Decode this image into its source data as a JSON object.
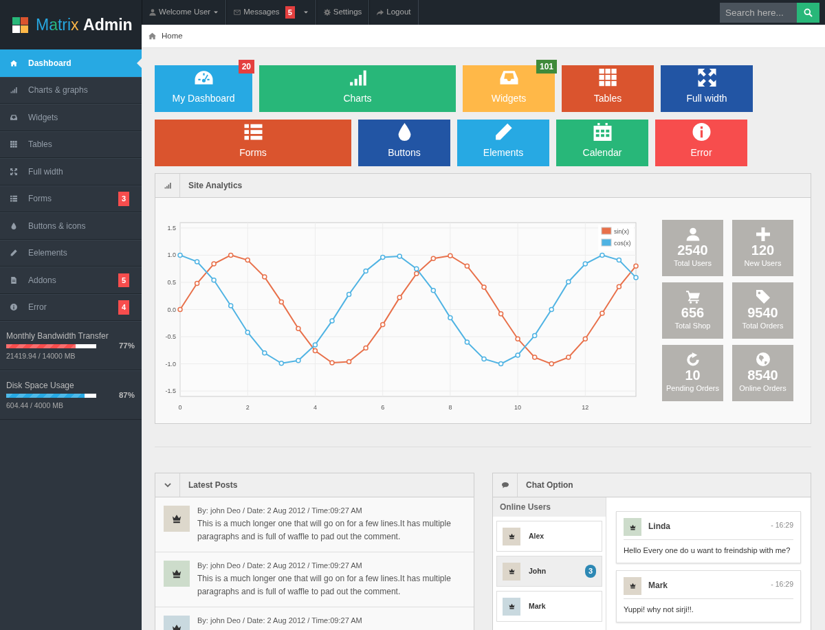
{
  "logo": {
    "name": "Matrix",
    "suffix": "Admin"
  },
  "top_nav": [
    {
      "label": "Welcome User",
      "dropdown": true
    },
    {
      "label": "Messages",
      "count": "5",
      "dropdown": true
    },
    {
      "label": "Settings",
      "dropdown": false
    },
    {
      "label": "Logout",
      "dropdown": false
    }
  ],
  "search": {
    "placeholder": "Search here..."
  },
  "breadcrumb": [
    "Home"
  ],
  "sidebar": {
    "items": [
      {
        "label": "Dashboard",
        "selected": true
      },
      {
        "label": "Charts & graphs",
        "selected": false
      },
      {
        "label": "Widgets",
        "selected": false
      },
      {
        "label": "Tables",
        "selected": false
      },
      {
        "label": "Full width",
        "selected": false
      },
      {
        "label": "Forms",
        "selected": false,
        "count": "3"
      },
      {
        "label": "Buttons & icons",
        "selected": false
      },
      {
        "label": "Eelements",
        "selected": false
      },
      {
        "label": "Addons",
        "selected": false,
        "count": "5"
      },
      {
        "label": "Error",
        "selected": false,
        "count": "4"
      }
    ],
    "meters": [
      {
        "label": "Monthly Bandwidth Transfer",
        "level": 0.77,
        "percent": "77%",
        "detail": "21419.94 / 14000 MB",
        "color": "#f74d4d"
      },
      {
        "label": "Disk Space Usage",
        "level": 0.87,
        "percent": "87%",
        "detail": "604.44 / 4000 MB",
        "color": "#27a9e3"
      }
    ]
  },
  "tiles": [
    {
      "label": "My Dashboard",
      "kind": "medium",
      "color": "#27a9e3",
      "badge": {
        "text": "20",
        "color": "#e43f3f"
      }
    },
    {
      "label": "Charts",
      "kind": "wide",
      "color": "#28b779"
    },
    {
      "label": "Widgets",
      "kind": "normal",
      "color": "#ffb848",
      "badge": {
        "text": "101",
        "color": "#3f8a3a"
      }
    },
    {
      "label": "Tables",
      "kind": "normal",
      "color": "#da542e"
    },
    {
      "label": "Full width",
      "kind": "normal",
      "color": "#2255a4"
    },
    {
      "label": "Forms",
      "kind": "wide",
      "color": "#da542e"
    },
    {
      "label": "Buttons",
      "kind": "normal",
      "color": "#2255a4"
    },
    {
      "label": "Elements",
      "kind": "normal",
      "color": "#27a9e3"
    },
    {
      "label": "Calendar",
      "kind": "normal",
      "color": "#28b779"
    },
    {
      "label": "Error",
      "kind": "normal",
      "color": "#f74d4d"
    }
  ],
  "analytics": {
    "title": "Site Analytics",
    "chart_data": {
      "type": "line",
      "grid": true,
      "legend": true,
      "xlim": [
        0,
        13.5
      ],
      "ylim": [
        -1.6,
        1.6
      ],
      "x": [
        0,
        0.5,
        1,
        1.5,
        2,
        2.5,
        3,
        3.5,
        4,
        4.5,
        5,
        5.5,
        6,
        6.5,
        7,
        7.5,
        8,
        8.5,
        9,
        9.5,
        10,
        10.5,
        11,
        11.5,
        12,
        12.5,
        13,
        13.5
      ],
      "series": [
        {
          "name": "sin(x)",
          "color": "#e8704a",
          "marker": "circle",
          "values": [
            0,
            0.48,
            0.84,
            1.0,
            0.91,
            0.6,
            0.14,
            -0.35,
            -0.76,
            -0.98,
            -0.96,
            -0.71,
            -0.28,
            0.22,
            0.66,
            0.94,
            0.99,
            0.8,
            0.41,
            -0.08,
            -0.54,
            -0.88,
            -1.0,
            -0.88,
            -0.54,
            -0.07,
            0.42,
            0.8
          ]
        },
        {
          "name": "cos(x)",
          "color": "#4fb3e3",
          "marker": "circle",
          "values": [
            1,
            0.88,
            0.54,
            0.07,
            -0.42,
            -0.8,
            -0.99,
            -0.94,
            -0.65,
            -0.21,
            0.28,
            0.71,
            0.96,
            0.98,
            0.75,
            0.35,
            -0.15,
            -0.6,
            -0.91,
            -1.0,
            -0.84,
            -0.48,
            0.0,
            0.51,
            0.84,
            1.0,
            0.91,
            0.59
          ]
        }
      ],
      "xticks": [
        0,
        2,
        4,
        6,
        8,
        10,
        12
      ],
      "yticks": [
        {
          "value": 1.5,
          "label": "1.5"
        },
        {
          "value": 1,
          "label": "1.0"
        },
        {
          "value": 0.5,
          "label": "0.5"
        },
        {
          "value": 0,
          "label": "0.0"
        },
        {
          "value": -0.5,
          "label": "-0.5"
        },
        {
          "value": -1,
          "label": "-1.0"
        },
        {
          "value": -1.5,
          "label": "-1.5"
        }
      ]
    },
    "stats": [
      {
        "value": "2540",
        "label": "Total Users"
      },
      {
        "value": "120",
        "label": "New Users"
      },
      {
        "value": "656",
        "label": "Total Shop"
      },
      {
        "value": "9540",
        "label": "Total Orders"
      },
      {
        "value": "10",
        "label": "Pending Orders"
      },
      {
        "value": "8540",
        "label": "Online Orders"
      }
    ]
  },
  "latest_posts": {
    "title": "Latest Posts",
    "posts": [
      {
        "meta": "By: john Deo / Date: 2 Aug 2012 / Time:09:27 AM",
        "text": "This is a much longer one that will go on for a few lines.It has multiple paragraphs and is full of waffle to pad out the comment.",
        "avatar": {
          "color": "#ddd8cc"
        }
      },
      {
        "meta": "By: john Deo / Date: 2 Aug 2012 / Time:09:27 AM",
        "text": "This is a much longer one that will go on for a few lines.It has multiple paragraphs and is full of waffle to pad out the comment.",
        "avatar": {
          "color": "#cddccb"
        }
      },
      {
        "meta": "By: john Deo / Date: 2 Aug 2012 / Time:09:27 AM",
        "avatar": {
          "color": "#c9d9df"
        }
      }
    ]
  },
  "chat": {
    "title": "Chat Option",
    "online_title": "Online Users",
    "users": [
      {
        "name": "Alex",
        "selected": false,
        "avatar": {
          "color": "#ddd6ca"
        }
      },
      {
        "name": "John",
        "selected": true,
        "count": "3",
        "avatar": {
          "color": "#ddd6ca"
        }
      },
      {
        "name": "Mark",
        "selected": false,
        "avatar": {
          "color": "#c9d9df"
        }
      }
    ],
    "messages": [
      {
        "author": "Linda",
        "time": "- 16:29",
        "text": "Hello Every one do u want to freindship with me?",
        "avatar": {
          "color": "#cddccb"
        }
      },
      {
        "author": "Mark",
        "time": "- 16:29",
        "text": "Yuppi! why not sirji!!.",
        "avatar": {
          "color": "#ddd6ca"
        }
      }
    ]
  }
}
